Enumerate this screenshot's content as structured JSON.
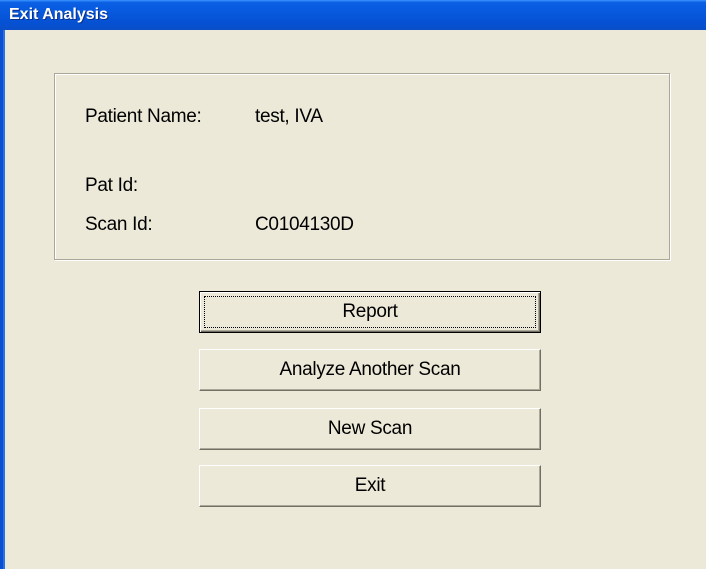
{
  "window": {
    "title": "Exit Analysis"
  },
  "patient_info": {
    "patient_name_label": "Patient Name:",
    "patient_name_value": "test, IVA",
    "pat_id_label": "Pat Id:",
    "pat_id_value": "",
    "scan_id_label": "Scan Id:",
    "scan_id_value": "C0104130D"
  },
  "buttons": {
    "report": "Report",
    "analyze_another_scan": "Analyze Another Scan",
    "new_scan": "New Scan",
    "exit": "Exit"
  },
  "colors": {
    "title_bar": "#0758dc",
    "dialog_background": "#ece9d8"
  }
}
